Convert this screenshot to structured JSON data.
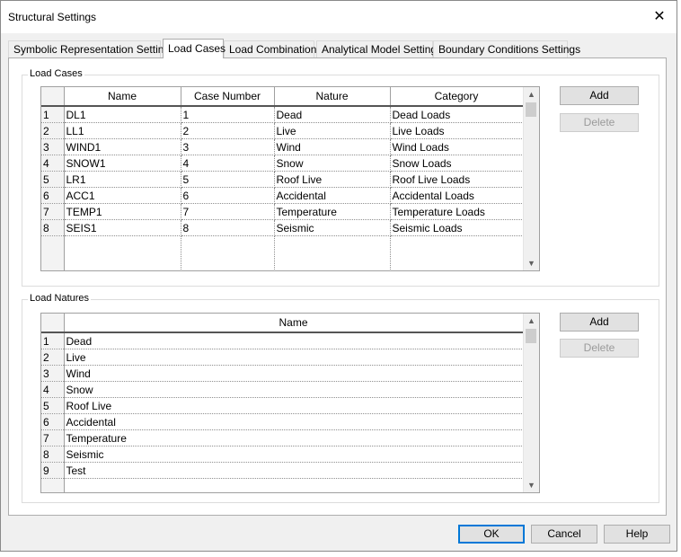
{
  "window": {
    "title": "Structural Settings",
    "close_label": "✕"
  },
  "tabs": [
    {
      "label": "Symbolic Representation Settings"
    },
    {
      "label": "Load Cases"
    },
    {
      "label": "Load Combinations"
    },
    {
      "label": "Analytical Model Settings"
    },
    {
      "label": "Boundary Conditions Settings"
    }
  ],
  "load_cases": {
    "group_label": "Load Cases",
    "columns": [
      "Name",
      "Case Number",
      "Nature",
      "Category"
    ],
    "rows": [
      {
        "num": "1",
        "name": "DL1",
        "case_number": "1",
        "nature": "Dead",
        "category": "Dead Loads"
      },
      {
        "num": "2",
        "name": "LL1",
        "case_number": "2",
        "nature": "Live",
        "category": "Live Loads"
      },
      {
        "num": "3",
        "name": "WIND1",
        "case_number": "3",
        "nature": "Wind",
        "category": "Wind Loads"
      },
      {
        "num": "4",
        "name": "SNOW1",
        "case_number": "4",
        "nature": "Snow",
        "category": "Snow Loads"
      },
      {
        "num": "5",
        "name": "LR1",
        "case_number": "5",
        "nature": "Roof Live",
        "category": "Roof Live Loads"
      },
      {
        "num": "6",
        "name": "ACC1",
        "case_number": "6",
        "nature": "Accidental",
        "category": "Accidental Loads"
      },
      {
        "num": "7",
        "name": "TEMP1",
        "case_number": "7",
        "nature": "Temperature",
        "category": "Temperature Loads"
      },
      {
        "num": "8",
        "name": "SEIS1",
        "case_number": "8",
        "nature": "Seismic",
        "category": "Seismic Loads"
      }
    ],
    "add_label": "Add",
    "delete_label": "Delete"
  },
  "load_natures": {
    "group_label": "Load Natures",
    "columns": [
      "Name"
    ],
    "rows": [
      {
        "num": "1",
        "name": "Dead"
      },
      {
        "num": "2",
        "name": "Live"
      },
      {
        "num": "3",
        "name": "Wind"
      },
      {
        "num": "4",
        "name": "Snow"
      },
      {
        "num": "5",
        "name": "Roof Live"
      },
      {
        "num": "6",
        "name": "Accidental"
      },
      {
        "num": "7",
        "name": "Temperature"
      },
      {
        "num": "8",
        "name": "Seismic"
      },
      {
        "num": "9",
        "name": "Test"
      }
    ],
    "add_label": "Add",
    "delete_label": "Delete"
  },
  "footer": {
    "ok_label": "OK",
    "cancel_label": "Cancel",
    "help_label": "Help"
  },
  "icons": {
    "scroll_up": "▲",
    "scroll_down": "▼"
  }
}
